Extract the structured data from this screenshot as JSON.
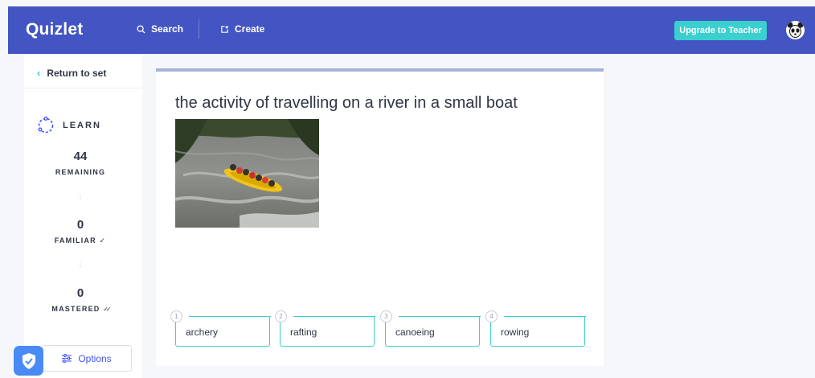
{
  "header": {
    "logo": "Quizlet",
    "search_label": "Search",
    "create_label": "Create",
    "upgrade_label": "Upgrade to Teacher",
    "bar_color": "#4255c2",
    "accent_color": "#3ccfcf"
  },
  "sidebar": {
    "return_label": "Return to set",
    "mode_label": "LEARN",
    "stats": [
      {
        "value": "44",
        "label": "REMAINING",
        "icon": ""
      },
      {
        "value": "0",
        "label": "FAMILIAR",
        "icon": "✓"
      },
      {
        "value": "0",
        "label": "MASTERED",
        "icon": "✓✓"
      }
    ],
    "options_label": "Options"
  },
  "question": {
    "prompt": "the activity of travelling on a river in a small boat",
    "image_icon": "rafting-photo"
  },
  "answers": [
    {
      "number": "1",
      "text": "archery"
    },
    {
      "number": "2",
      "text": "rafting"
    },
    {
      "number": "3",
      "text": "canoeing"
    },
    {
      "number": "4",
      "text": "rowing"
    }
  ]
}
